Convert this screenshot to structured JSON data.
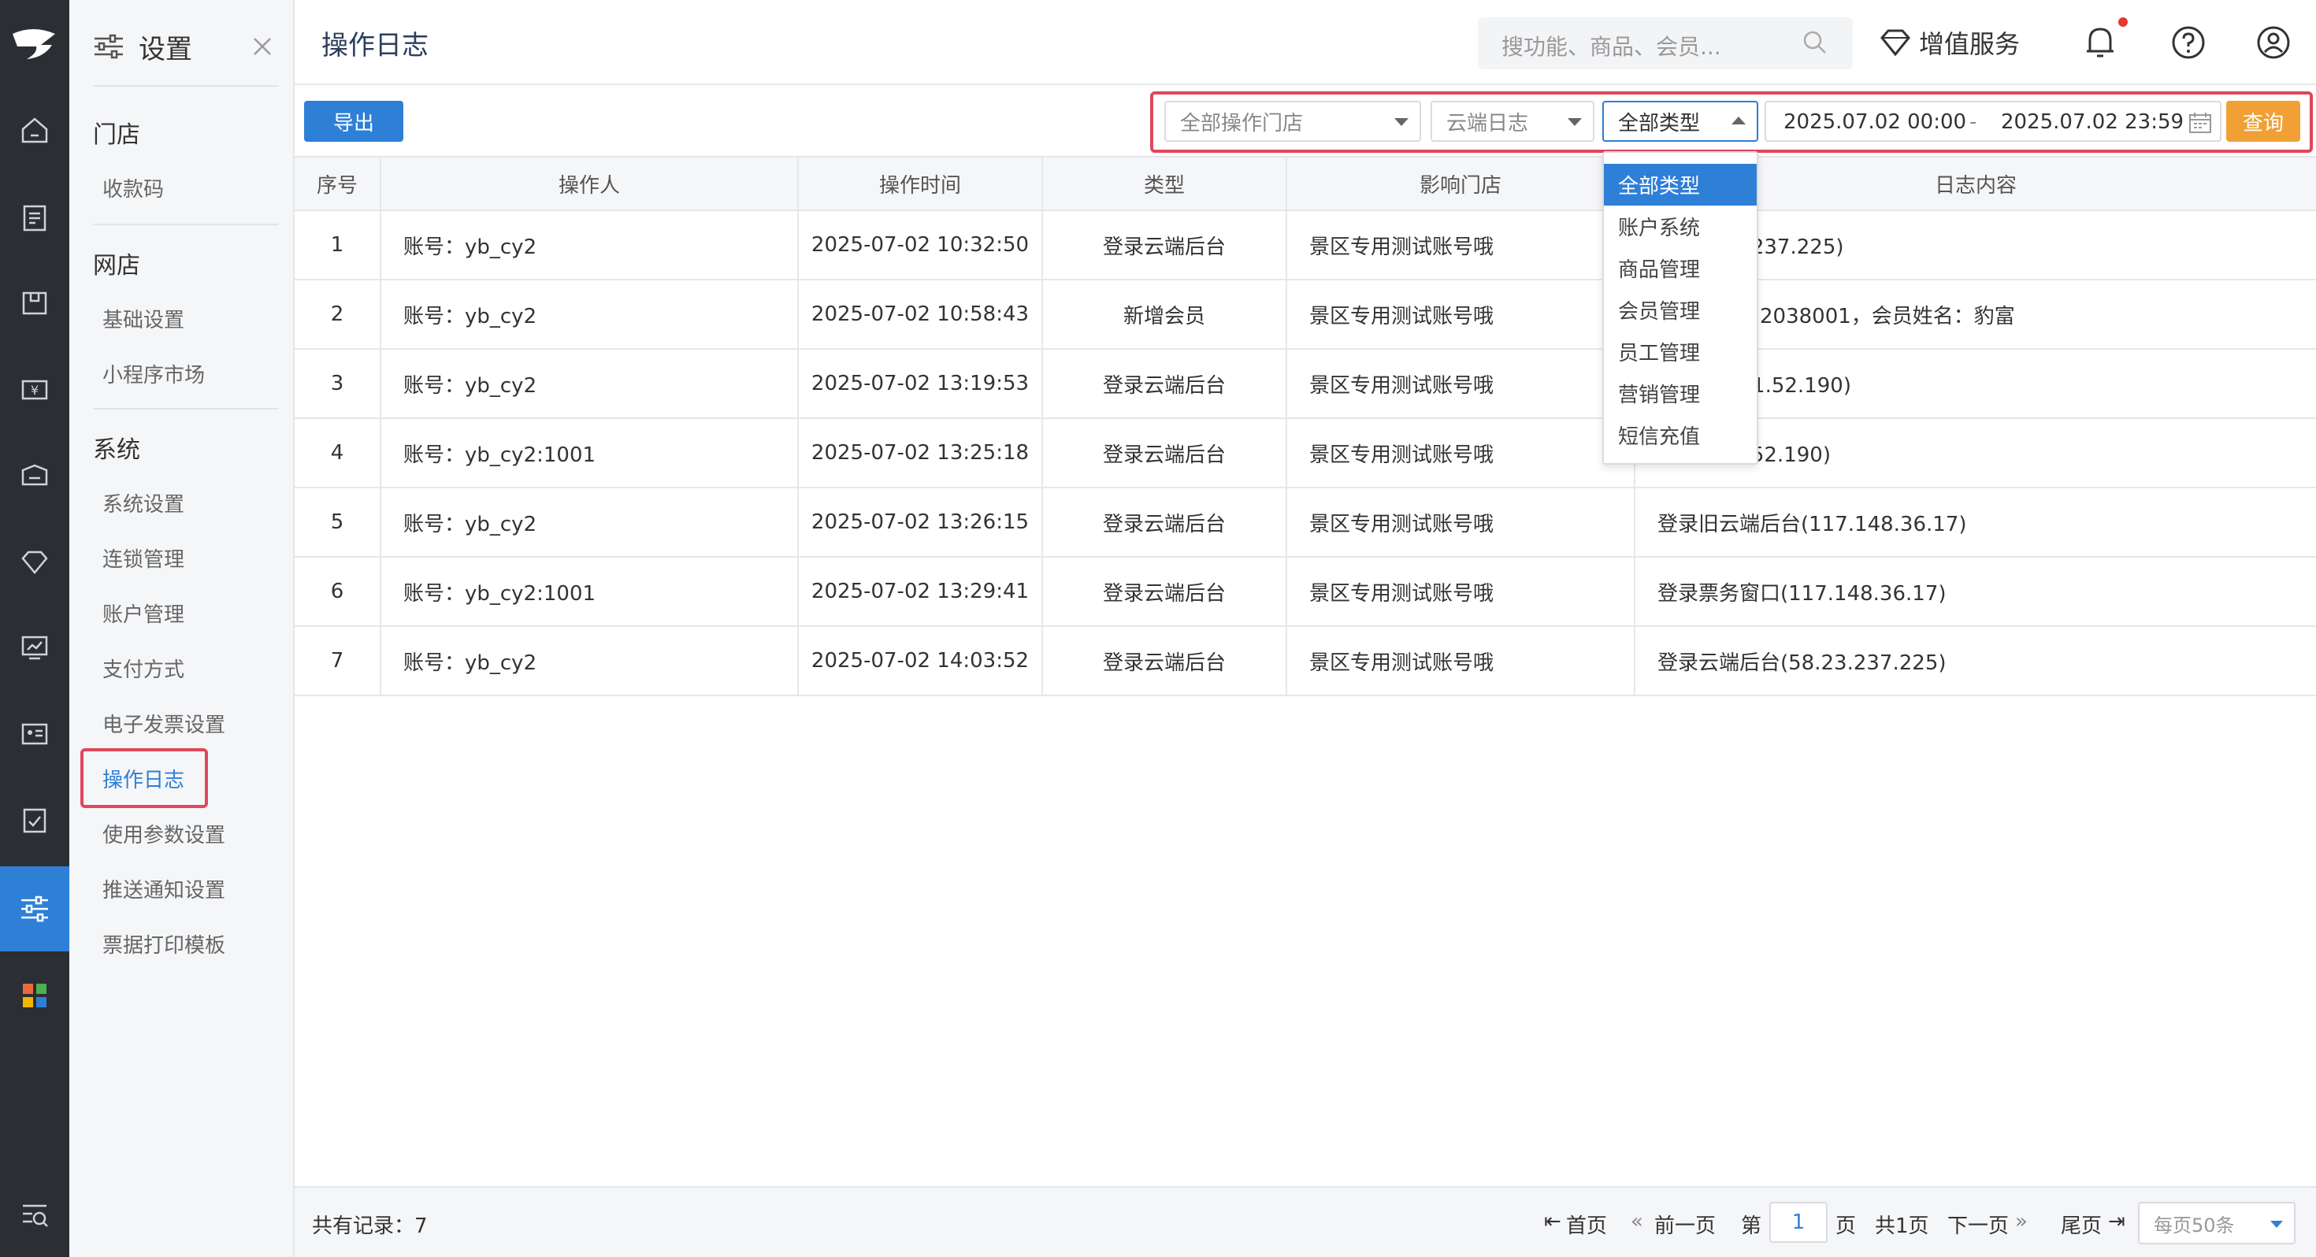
{
  "sidebar": {
    "title": "设置",
    "groups": [
      {
        "header": "门店",
        "items": [
          "收款码"
        ]
      },
      {
        "header": "网店",
        "items": [
          "基础设置",
          "小程序市场"
        ]
      },
      {
        "header": "系统",
        "items": [
          "系统设置",
          "连锁管理",
          "账户管理",
          "支付方式",
          "电子发票设置",
          "操作日志",
          "使用参数设置",
          "推送通知设置",
          "票据打印模板"
        ]
      }
    ],
    "active_item": "操作日志"
  },
  "header": {
    "page_title": "操作日志",
    "search_placeholder": "搜功能、商品、会员...",
    "vip_label": "增值服务"
  },
  "toolbar": {
    "export_label": "导出",
    "store_select": "全部操作门店",
    "log_select": "云端日志",
    "type_select": "全部类型",
    "date_start": "2025.07.02 00:00",
    "date_sep": "-",
    "date_end": "2025.07.02 23:59",
    "query_label": "查询"
  },
  "type_dropdown": {
    "options": [
      "全部类型",
      "账户系统",
      "商品管理",
      "会员管理",
      "员工管理",
      "营销管理",
      "短信充值"
    ],
    "selected": "全部类型"
  },
  "table": {
    "columns": [
      "序号",
      "操作人",
      "操作时间",
      "类型",
      "影响门店",
      "日志内容"
    ],
    "rows": [
      [
        "1",
        "账号：yb_cy2",
        "2025-07-02 10:32:50",
        "登录云端后台",
        "景区专用测试账号哦",
        "台(58.23.237.225)"
      ],
      [
        "2",
        "账号：yb_cy2",
        "2025-07-02 10:58:43",
        "新增会员",
        "景区专用测试账号哦",
        "会员编号：2038001，会员姓名：豹富"
      ],
      [
        "3",
        "账号：yb_cy2",
        "2025-07-02 13:19:53",
        "登录云端后台",
        "景区专用测试账号哦",
        "后台(112.1.52.190)"
      ],
      [
        "4",
        "账号：yb_cy2:1001",
        "2025-07-02 13:25:18",
        "登录云端后台",
        "景区专用测试账号哦",
        "口(112.1.52.190)"
      ],
      [
        "5",
        "账号：yb_cy2",
        "2025-07-02 13:26:15",
        "登录云端后台",
        "景区专用测试账号哦",
        "登录旧云端后台(117.148.36.17)"
      ],
      [
        "6",
        "账号：yb_cy2:1001",
        "2025-07-02 13:29:41",
        "登录云端后台",
        "景区专用测试账号哦",
        "登录票务窗口(117.148.36.17)"
      ],
      [
        "7",
        "账号：yb_cy2",
        "2025-07-02 14:03:52",
        "登录云端后台",
        "景区专用测试账号哦",
        "登录云端后台(58.23.237.225)"
      ]
    ]
  },
  "footer": {
    "total": "共有记录：7",
    "first": "首页",
    "prev": "前一页",
    "page_prefix": "第",
    "page_value": "1",
    "page_suffix": "页",
    "total_pages": "共1页",
    "next": "下一页",
    "last": "尾页",
    "per_page": "每页50条"
  },
  "colors": {
    "accent": "#2e7fd6",
    "highlight": "#e0475b",
    "query": "#f0a035",
    "rail": "#2b2e33"
  }
}
